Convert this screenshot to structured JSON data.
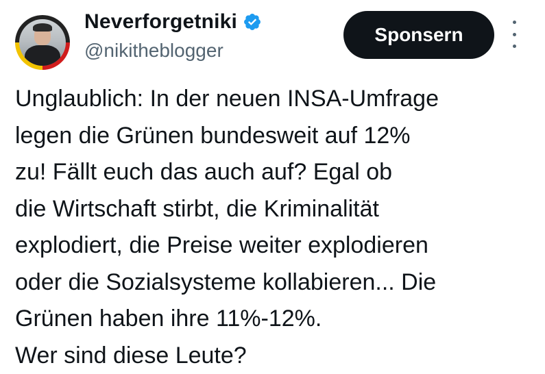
{
  "user": {
    "display_name": "Neverforgetniki",
    "handle": "@nikitheblogger",
    "verified": true
  },
  "actions": {
    "sponsor_label": "Sponsern",
    "more_icon": "more-vertical-icon"
  },
  "tweet": {
    "lines": [
      "Unglaublich: In der neuen INSA-Umfrage",
      "legen die Grünen bundesweit auf 12%",
      "zu! Fällt euch das auch auf? Egal ob",
      "die Wirtschaft stirbt, die Kriminalität",
      "explodiert, die Preise weiter explodieren",
      "oder die Sozialsysteme kollabieren... Die",
      "Grünen haben ihre 11%-12%.",
      "Wer sind diese Leute?"
    ]
  },
  "colors": {
    "text": "#0f1419",
    "secondary": "#536471",
    "verified": "#1d9bf0",
    "button_bg": "#0f1419"
  }
}
